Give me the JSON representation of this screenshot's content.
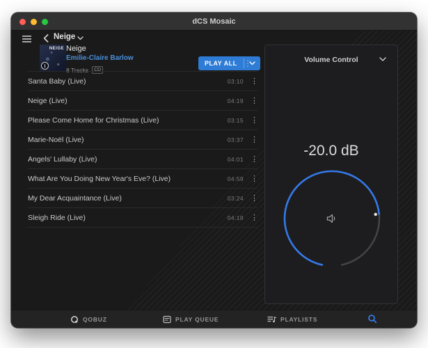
{
  "window": {
    "title": "dCS Mosaic"
  },
  "nav": {
    "breadcrumb": "Neige"
  },
  "album": {
    "title": "Neige",
    "artist": "Emilie-Claire Barlow",
    "track_count": "8 Tracks",
    "format_badge": "CD",
    "art_text": "NEIGE",
    "info_glyph": "i",
    "play_all_label": "PLAY ALL",
    "more_glyph": "⋮"
  },
  "tracks": [
    {
      "title": "Santa Baby (Live)",
      "duration": "03:10",
      "more_glyph": "⋮"
    },
    {
      "title": "Neige (Live)",
      "duration": "04:19",
      "more_glyph": "⋮"
    },
    {
      "title": "Please Come Home for Christmas (Live)",
      "duration": "03:15",
      "more_glyph": "⋮"
    },
    {
      "title": "Marie-Noël (Live)",
      "duration": "03:37",
      "more_glyph": "⋮"
    },
    {
      "title": "Angels' Lullaby (Live)",
      "duration": "04:01",
      "more_glyph": "⋮"
    },
    {
      "title": "What Are You Doing New Year's Eve? (Live)",
      "duration": "04:59",
      "more_glyph": "⋮"
    },
    {
      "title": "My Dear Acquaintance (Live)",
      "duration": "03:24",
      "more_glyph": "⋮"
    },
    {
      "title": "Sleigh Ride (Live)",
      "duration": "04:18",
      "more_glyph": "⋮"
    }
  ],
  "volume": {
    "panel_title": "Volume Control",
    "level": "-20.0 dB"
  },
  "bottom_bar": {
    "qobuz_label": "QOBUZ",
    "play_queue_label": "PLAY QUEUE",
    "playlists_label": "PLAYLISTS"
  },
  "colors": {
    "accent_button_blue": "#2e7cd6",
    "arc_blue": "#357ae8",
    "link_blue": "#4a8fd8",
    "search_blue": "#3b82f6"
  }
}
